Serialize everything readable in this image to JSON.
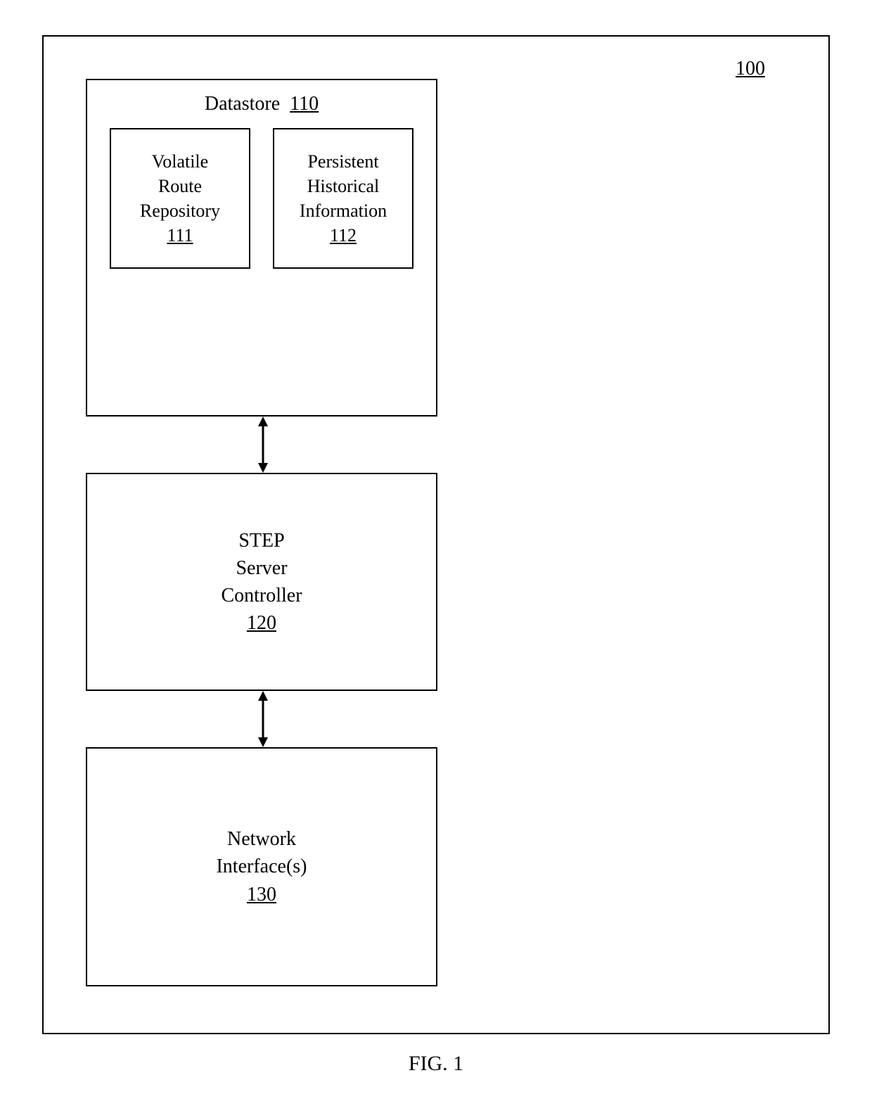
{
  "figure_ref": "100",
  "datastore": {
    "title_text": "Datastore",
    "title_ref": "110",
    "volatile": {
      "line1": "Volatile",
      "line2": "Route",
      "line3": "Repository",
      "ref": "111"
    },
    "persistent": {
      "line1": "Persistent",
      "line2": "Historical",
      "line3": "Information",
      "ref": "112"
    }
  },
  "step": {
    "line1": "STEP",
    "line2": "Server",
    "line3": "Controller",
    "ref": "120"
  },
  "network": {
    "line1": "Network",
    "line2": "Interface(s)",
    "ref": "130"
  },
  "caption": "FIG. 1"
}
